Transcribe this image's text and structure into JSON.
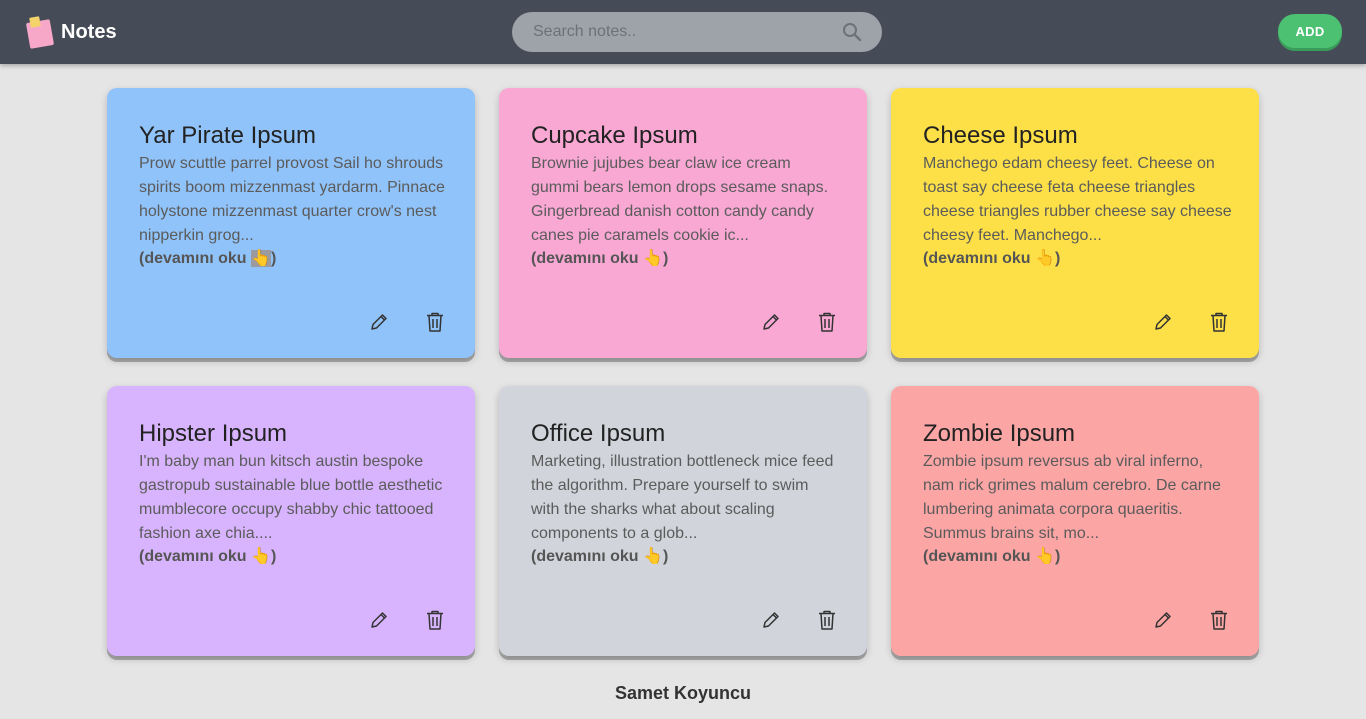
{
  "app": {
    "title": "Notes"
  },
  "search": {
    "placeholder": "Search notes.."
  },
  "header": {
    "add_label": "ADD"
  },
  "read_more": "(devamını oku",
  "read_more_close": ")",
  "notes": [
    {
      "title": "Yar Pirate Ipsum",
      "body": "Prow scuttle parrel provost Sail ho shrouds spirits boom mizzenmast yardarm. Pinnace holystone mizzenmast quarter crow's nest nipperkin grog...",
      "color": "#90c3fa"
    },
    {
      "title": "Cupcake Ipsum",
      "body": "Brownie jujubes bear claw ice cream gummi bears lemon drops sesame snaps. Gingerbread danish cotton candy candy canes pie caramels cookie ic...",
      "color": "#f9a8d4"
    },
    {
      "title": "Cheese Ipsum",
      "body": "Manchego edam cheesy feet. Cheese on toast say cheese feta cheese triangles cheese triangles rubber cheese say cheese cheesy feet. Manchego...",
      "color": "#fde047"
    },
    {
      "title": "Hipster Ipsum",
      "body": "I'm baby man bun kitsch austin bespoke gastropub sustainable blue bottle aesthetic mumblecore occupy shabby chic tattooed fashion axe chia....",
      "color": "#d8b4fe"
    },
    {
      "title": "Office Ipsum",
      "body": "Marketing, illustration bottleneck mice feed the algorithm. Prepare yourself to swim with the sharks what about scaling components to a glob...",
      "color": "#d1d5db"
    },
    {
      "title": "Zombie Ipsum",
      "body": "Zombie ipsum reversus ab viral inferno, nam rick grimes malum cerebro. De carne lumbering animata corpora quaeritis. Summus brains sit, mo...",
      "color": "#fca5a5"
    }
  ],
  "icons": {
    "hand": "👆",
    "edit": "pencil-icon",
    "delete": "trash-icon",
    "search": "magnifier-icon",
    "logo": "sticky-notes-icon"
  },
  "footer": {
    "author": "Samet Koyuncu"
  }
}
